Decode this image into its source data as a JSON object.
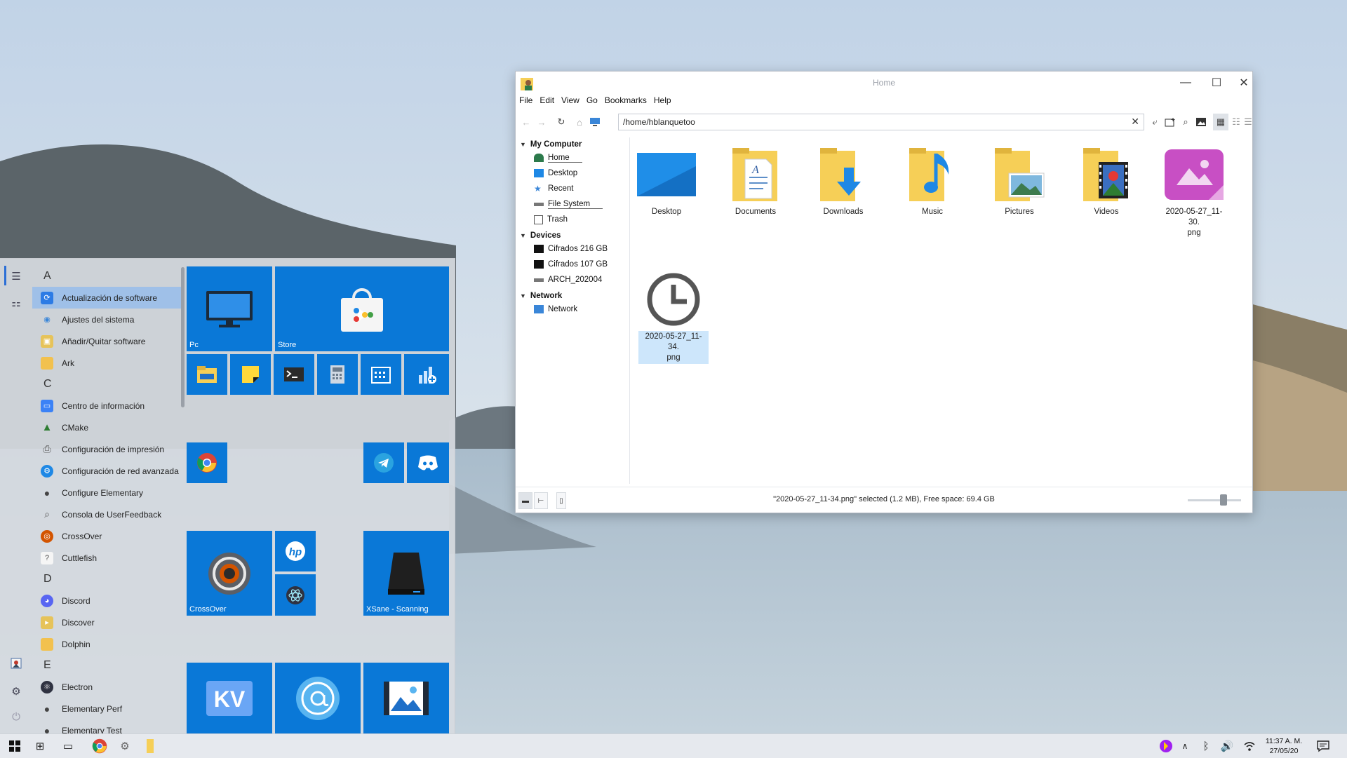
{
  "start_menu": {
    "letters": [
      "A",
      "C",
      "D",
      "E"
    ],
    "apps_a": [
      {
        "label": "Actualización de software",
        "icon": "software-update-icon",
        "color": "#2c7be5",
        "selected": true
      },
      {
        "label": "Ajustes del sistema",
        "icon": "system-settings-icon",
        "color": "#3a86d8"
      },
      {
        "label": "Añadir/Quitar software",
        "icon": "add-remove-software-icon",
        "color": "#e6c35a"
      },
      {
        "label": "Ark",
        "icon": "ark-icon",
        "color": "#f2c14e"
      }
    ],
    "apps_c": [
      {
        "label": "Centro de información",
        "icon": "info-center-icon",
        "color": "#3b82f6"
      },
      {
        "label": "CMake",
        "icon": "cmake-icon",
        "color": "#2e7d32"
      },
      {
        "label": "Configuración de impresión",
        "icon": "printer-icon",
        "color": "#555555"
      },
      {
        "label": "Configuración de red avanzada",
        "icon": "network-config-icon",
        "color": "#1e88e5"
      },
      {
        "label": "Configure Elementary",
        "icon": "elementary-icon",
        "color": "#444444"
      },
      {
        "label": "Consola de UserFeedback",
        "icon": "magnifier-icon",
        "color": "#555555"
      },
      {
        "label": "CrossOver",
        "icon": "crossover-icon",
        "color": "#d35400"
      },
      {
        "label": "Cuttlefish",
        "icon": "cuttlefish-icon",
        "color": "#f5f5f5"
      }
    ],
    "apps_d": [
      {
        "label": "Discord",
        "icon": "discord-icon",
        "color": "#5865f2"
      },
      {
        "label": "Discover",
        "icon": "discover-icon",
        "color": "#e6c35a"
      },
      {
        "label": "Dolphin",
        "icon": "dolphin-icon",
        "color": "#f2c14e"
      }
    ],
    "apps_e": [
      {
        "label": "Electron",
        "icon": "electron-icon",
        "color": "#2f3241"
      },
      {
        "label": "Elementary Perf",
        "icon": "elementary-perf-icon",
        "color": "#444444"
      },
      {
        "label": "Elementary Test",
        "icon": "elementary-test-icon",
        "color": "#444444"
      }
    ],
    "tiles": {
      "pc": "Pc",
      "store": "Store",
      "crossover": "CrossOver",
      "xsane": "XSane - Scanning",
      "kv": "KV"
    }
  },
  "file_manager": {
    "title": "Home",
    "menu": [
      "File",
      "Edit",
      "View",
      "Go",
      "Bookmarks",
      "Help"
    ],
    "address": "/home/hblanquetoo",
    "sidebar": {
      "my_computer": "My Computer",
      "computer_items": [
        "Home",
        "Desktop",
        "Recent",
        "File System",
        "Trash"
      ],
      "devices": "Devices",
      "device_items": [
        "Cifrados 216 GB",
        "Cifrados 107 GB",
        "ARCH_202004"
      ],
      "network": "Network",
      "network_items": [
        "Network"
      ]
    },
    "files": [
      {
        "name": "Desktop"
      },
      {
        "name": "Documents"
      },
      {
        "name": "Downloads"
      },
      {
        "name": "Music"
      },
      {
        "name": "Pictures"
      },
      {
        "name": "Videos"
      },
      {
        "name": "2020-05-27_11-30.\npng"
      },
      {
        "name": "2020-05-27_11-34.\npng"
      }
    ],
    "status": "\"2020-05-27_11-34.png\" selected (1.2 MB), Free space: 69.4 GB"
  },
  "taskbar": {
    "time": "11:37 A. M.",
    "date": "27/05/20"
  },
  "colors": {
    "tile": "#0a78d7",
    "accent": "#2b6fd6",
    "selection": "#cde6fb",
    "folder": "#f6cf57"
  }
}
